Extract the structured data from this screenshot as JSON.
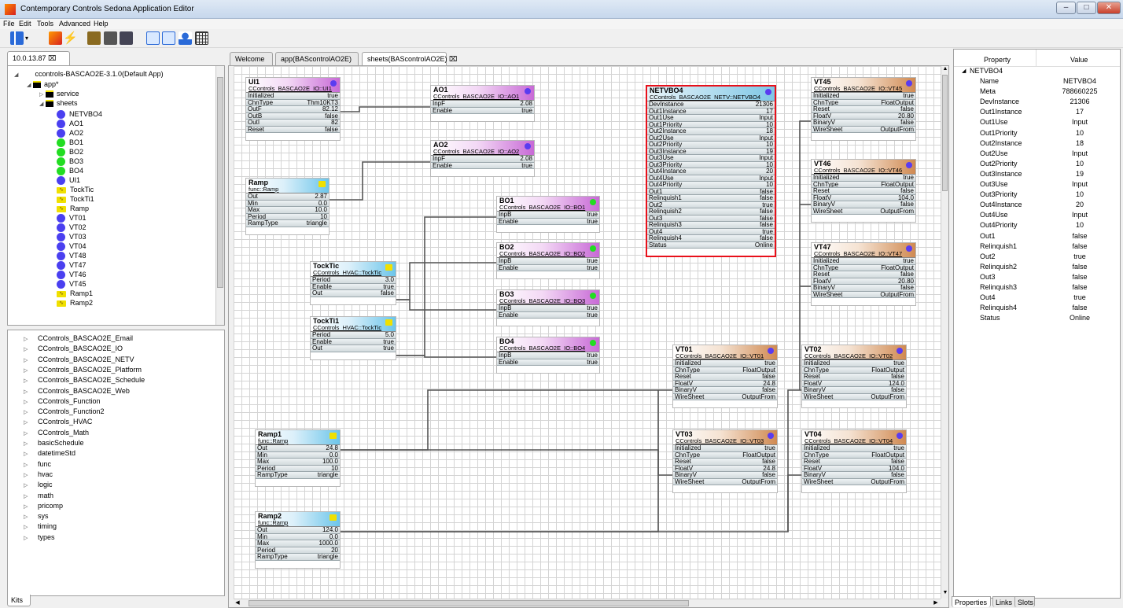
{
  "window": {
    "title": "Contemporary Controls Sedona Application Editor"
  },
  "menu": [
    "File",
    "Edit",
    "Tools",
    "Advanced",
    "Help"
  ],
  "left_tab": {
    "label": "10.0.13.87"
  },
  "tree": {
    "root": "ccontrols-BASCAO2E-3.1.0(Default App)",
    "app": "app*",
    "folders": [
      "service",
      "sheets"
    ],
    "items": [
      {
        "label": "NETVBO4",
        "icon": "dot",
        "color": "#4a3ff0"
      },
      {
        "label": "AO1",
        "icon": "dot",
        "color": "#4a3ff0"
      },
      {
        "label": "AO2",
        "icon": "dot",
        "color": "#4a3ff0"
      },
      {
        "label": "BO1",
        "icon": "dot",
        "color": "#22dd22"
      },
      {
        "label": "BO2",
        "icon": "dot",
        "color": "#22dd22"
      },
      {
        "label": "BO3",
        "icon": "dot",
        "color": "#22dd22"
      },
      {
        "label": "BO4",
        "icon": "dot",
        "color": "#22dd22"
      },
      {
        "label": "UI1",
        "icon": "dot",
        "color": "#4a3ff0"
      },
      {
        "label": "TockTic",
        "icon": "zig",
        "color": "#f0e000"
      },
      {
        "label": "TockTi1",
        "icon": "zig",
        "color": "#f0e000"
      },
      {
        "label": "Ramp",
        "icon": "zig",
        "color": "#f0e000"
      },
      {
        "label": "VT01",
        "icon": "dot",
        "color": "#4a3ff0"
      },
      {
        "label": "VT02",
        "icon": "dot",
        "color": "#4a3ff0"
      },
      {
        "label": "VT03",
        "icon": "dot",
        "color": "#4a3ff0"
      },
      {
        "label": "VT04",
        "icon": "dot",
        "color": "#4a3ff0"
      },
      {
        "label": "VT48",
        "icon": "dot",
        "color": "#4a3ff0"
      },
      {
        "label": "VT47",
        "icon": "dot",
        "color": "#4a3ff0"
      },
      {
        "label": "VT46",
        "icon": "dot",
        "color": "#4a3ff0"
      },
      {
        "label": "VT45",
        "icon": "dot",
        "color": "#4a3ff0"
      },
      {
        "label": "Ramp1",
        "icon": "zig",
        "color": "#f0e000"
      },
      {
        "label": "Ramp2",
        "icon": "zig",
        "color": "#f0e000"
      }
    ]
  },
  "kits": [
    "CControls_BASCAO2E_Email",
    "CControls_BASCAO2E_IO",
    "CControls_BASCAO2E_NETV",
    "CControls_BASCAO2E_Platform",
    "CControls_BASCAO2E_Schedule",
    "CControls_BASCAO2E_Web",
    "CControls_Function",
    "CControls_Function2",
    "CControls_HVAC",
    "CControls_Math",
    "basicSchedule",
    "datetimeStd",
    "func",
    "hvac",
    "logic",
    "math",
    "pricomp",
    "sys",
    "timing",
    "types"
  ],
  "kits_tab": "Kits",
  "editor_tabs": [
    "Welcome",
    "app(BAScontrolAO2E)",
    "sheets(BAScontrolAO2E)"
  ],
  "components": {
    "UI1": {
      "title": "UI1",
      "type": "CControls_BASCAO2E_IO::UI1",
      "slots": [
        [
          "Initialized",
          "true"
        ],
        [
          "ChnType",
          "Thm10KT3"
        ],
        [
          "OutF",
          "82.12"
        ],
        [
          "OutB",
          "false"
        ],
        [
          "OutI",
          "82"
        ],
        [
          "Reset",
          "false"
        ]
      ]
    },
    "AO1": {
      "title": "AO1",
      "type": "CControls_BASCAO2E_IO::AO1",
      "slots": [
        [
          "InpF",
          "2.08"
        ],
        [
          "Enable",
          "true"
        ]
      ]
    },
    "AO2": {
      "title": "AO2",
      "type": "CControls_BASCAO2E_IO::AO2",
      "slots": [
        [
          "InpF",
          "2.08"
        ],
        [
          "Enable",
          "true"
        ]
      ]
    },
    "Ramp": {
      "title": "Ramp",
      "type": "func::Ramp",
      "slots": [
        [
          "Out",
          "2.87"
        ],
        [
          "Min",
          "0.0"
        ],
        [
          "Max",
          "10.0"
        ],
        [
          "Period",
          "10"
        ],
        [
          "RampType",
          "triangle"
        ]
      ]
    },
    "BO1": {
      "title": "BO1",
      "type": "CControls_BASCAO2E_IO::BO1",
      "slots": [
        [
          "InpB",
          "true"
        ],
        [
          "Enable",
          "true"
        ]
      ]
    },
    "BO2": {
      "title": "BO2",
      "type": "CControls_BASCAO2E_IO::BO2",
      "slots": [
        [
          "InpB",
          "true"
        ],
        [
          "Enable",
          "true"
        ]
      ]
    },
    "BO3": {
      "title": "BO3",
      "type": "CControls_BASCAO2E_IO::BO3",
      "slots": [
        [
          "InpB",
          "true"
        ],
        [
          "Enable",
          "true"
        ]
      ]
    },
    "BO4": {
      "title": "BO4",
      "type": "CControls_BASCAO2E_IO::BO4",
      "slots": [
        [
          "InpB",
          "true"
        ],
        [
          "Enable",
          "true"
        ]
      ]
    },
    "TockTic": {
      "title": "TockTic",
      "type": "CControls_HVAC::TockTic",
      "slots": [
        [
          "Period",
          "3.0"
        ],
        [
          "Enable",
          "true"
        ],
        [
          "Out",
          "false"
        ]
      ]
    },
    "TockTi1": {
      "title": "TockTi1",
      "type": "CControls_HVAC::TockTic",
      "slots": [
        [
          "Period",
          "5.0"
        ],
        [
          "Enable",
          "true"
        ],
        [
          "Out",
          "true"
        ]
      ]
    },
    "NETVBO4": {
      "title": "NETVBO4",
      "type": "CControls_BASCAO2E_NETV::NETVBO4",
      "slots": [
        [
          "DevInstance",
          "21306"
        ],
        [
          "Out1Instance",
          "17"
        ],
        [
          "Out1Use",
          "Input"
        ],
        [
          "Out1Priority",
          "10"
        ],
        [
          "Out2Instance",
          "18"
        ],
        [
          "Out2Use",
          "Input"
        ],
        [
          "Out2Priority",
          "10"
        ],
        [
          "Out3Instance",
          "19"
        ],
        [
          "Out3Use",
          "Input"
        ],
        [
          "Out3Priority",
          "10"
        ],
        [
          "Out4Instance",
          "20"
        ],
        [
          "Out4Use",
          "Input"
        ],
        [
          "Out4Priority",
          "10"
        ],
        [
          "Out1",
          "false"
        ],
        [
          "Relinquish1",
          "false"
        ],
        [
          "Out2",
          "true"
        ],
        [
          "Relinquish2",
          "false"
        ],
        [
          "Out3",
          "false"
        ],
        [
          "Relinquish3",
          "false"
        ],
        [
          "Out4",
          "true"
        ],
        [
          "Relinquish4",
          "false"
        ],
        [
          "Status",
          "Online"
        ]
      ]
    },
    "VT45": {
      "title": "VT45",
      "type": "CControls_BASCAO2E_IO::VT45",
      "slots": [
        [
          "Initialized",
          "true"
        ],
        [
          "ChnType",
          "FloatOutput"
        ],
        [
          "Reset",
          "false"
        ],
        [
          "FloatV",
          "20.80"
        ],
        [
          "BinaryV",
          "false"
        ],
        [
          "WireSheet",
          "OutputFrom"
        ]
      ]
    },
    "VT46": {
      "title": "VT46",
      "type": "CControls_BASCAO2E_IO::VT46",
      "slots": [
        [
          "Initialized",
          "true"
        ],
        [
          "ChnType",
          "FloatOutput"
        ],
        [
          "Reset",
          "false"
        ],
        [
          "FloatV",
          "104.0"
        ],
        [
          "BinaryV",
          "false"
        ],
        [
          "WireSheet",
          "OutputFrom"
        ]
      ]
    },
    "VT47": {
      "title": "VT47",
      "type": "CControls_BASCAO2E_IO::VT47",
      "slots": [
        [
          "Initialized",
          "true"
        ],
        [
          "ChnType",
          "FloatOutput"
        ],
        [
          "Reset",
          "false"
        ],
        [
          "FloatV",
          "20.80"
        ],
        [
          "BinaryV",
          "false"
        ],
        [
          "WireSheet",
          "OutputFrom"
        ]
      ]
    },
    "VT01": {
      "title": "VT01",
      "type": "CControls_BASCAO2E_IO::VT01",
      "slots": [
        [
          "Initialized",
          "true"
        ],
        [
          "ChnType",
          "FloatOutput"
        ],
        [
          "Reset",
          "false"
        ],
        [
          "FloatV",
          "24.8"
        ],
        [
          "BinaryV",
          "false"
        ],
        [
          "WireSheet",
          "OutputFrom"
        ]
      ]
    },
    "VT02": {
      "title": "VT02",
      "type": "CControls_BASCAO2E_IO::VT02",
      "slots": [
        [
          "Initialized",
          "true"
        ],
        [
          "ChnType",
          "FloatOutput"
        ],
        [
          "Reset",
          "false"
        ],
        [
          "FloatV",
          "124.0"
        ],
        [
          "BinaryV",
          "false"
        ],
        [
          "WireSheet",
          "OutputFrom"
        ]
      ]
    },
    "VT03": {
      "title": "VT03",
      "type": "CControls_BASCAO2E_IO::VT03",
      "slots": [
        [
          "Initialized",
          "true"
        ],
        [
          "ChnType",
          "FloatOutput"
        ],
        [
          "Reset",
          "false"
        ],
        [
          "FloatV",
          "24.8"
        ],
        [
          "BinaryV",
          "false"
        ],
        [
          "WireSheet",
          "OutputFrom"
        ]
      ]
    },
    "VT04": {
      "title": "VT04",
      "type": "CControls_BASCAO2E_IO::VT04",
      "slots": [
        [
          "Initialized",
          "true"
        ],
        [
          "ChnType",
          "FloatOutput"
        ],
        [
          "Reset",
          "false"
        ],
        [
          "FloatV",
          "104.0"
        ],
        [
          "BinaryV",
          "false"
        ],
        [
          "WireSheet",
          "OutputFrom"
        ]
      ]
    },
    "Ramp1": {
      "title": "Ramp1",
      "type": "func::Ramp",
      "slots": [
        [
          "Out",
          "24.8"
        ],
        [
          "Min",
          "0.0"
        ],
        [
          "Max",
          "100.0"
        ],
        [
          "Period",
          "10"
        ],
        [
          "RampType",
          "triangle"
        ]
      ]
    },
    "Ramp2": {
      "title": "Ramp2",
      "type": "func::Ramp",
      "slots": [
        [
          "Out",
          "124.0"
        ],
        [
          "Min",
          "0.0"
        ],
        [
          "Max",
          "1000.0"
        ],
        [
          "Period",
          "20"
        ],
        [
          "RampType",
          "triangle"
        ]
      ]
    }
  },
  "properties": {
    "headers": [
      "Property",
      "Value"
    ],
    "group": "NETVBO4",
    "rows": [
      [
        "Name",
        "NETVBO4"
      ],
      [
        "Meta",
        "788660225"
      ],
      [
        "DevInstance",
        "21306"
      ],
      [
        "Out1Instance",
        "17"
      ],
      [
        "Out1Use",
        "Input"
      ],
      [
        "Out1Priority",
        "10"
      ],
      [
        "Out2Instance",
        "18"
      ],
      [
        "Out2Use",
        "Input"
      ],
      [
        "Out2Priority",
        "10"
      ],
      [
        "Out3Instance",
        "19"
      ],
      [
        "Out3Use",
        "Input"
      ],
      [
        "Out3Priority",
        "10"
      ],
      [
        "Out4Instance",
        "20"
      ],
      [
        "Out4Use",
        "Input"
      ],
      [
        "Out4Priority",
        "10"
      ],
      [
        "Out1",
        "false"
      ],
      [
        "Relinquish1",
        "false"
      ],
      [
        "Out2",
        "true"
      ],
      [
        "Relinquish2",
        "false"
      ],
      [
        "Out3",
        "false"
      ],
      [
        "Relinquish3",
        "false"
      ],
      [
        "Out4",
        "true"
      ],
      [
        "Relinquish4",
        "false"
      ],
      [
        "Status",
        "Online"
      ]
    ],
    "bottom_tabs": [
      "Properties",
      "Links",
      "Slots"
    ]
  },
  "colors": {
    "purple_icon": "#5a3cf0",
    "green_icon": "#22dd22",
    "yellow_icon": "#f0e000",
    "selection": "#e8101a"
  }
}
